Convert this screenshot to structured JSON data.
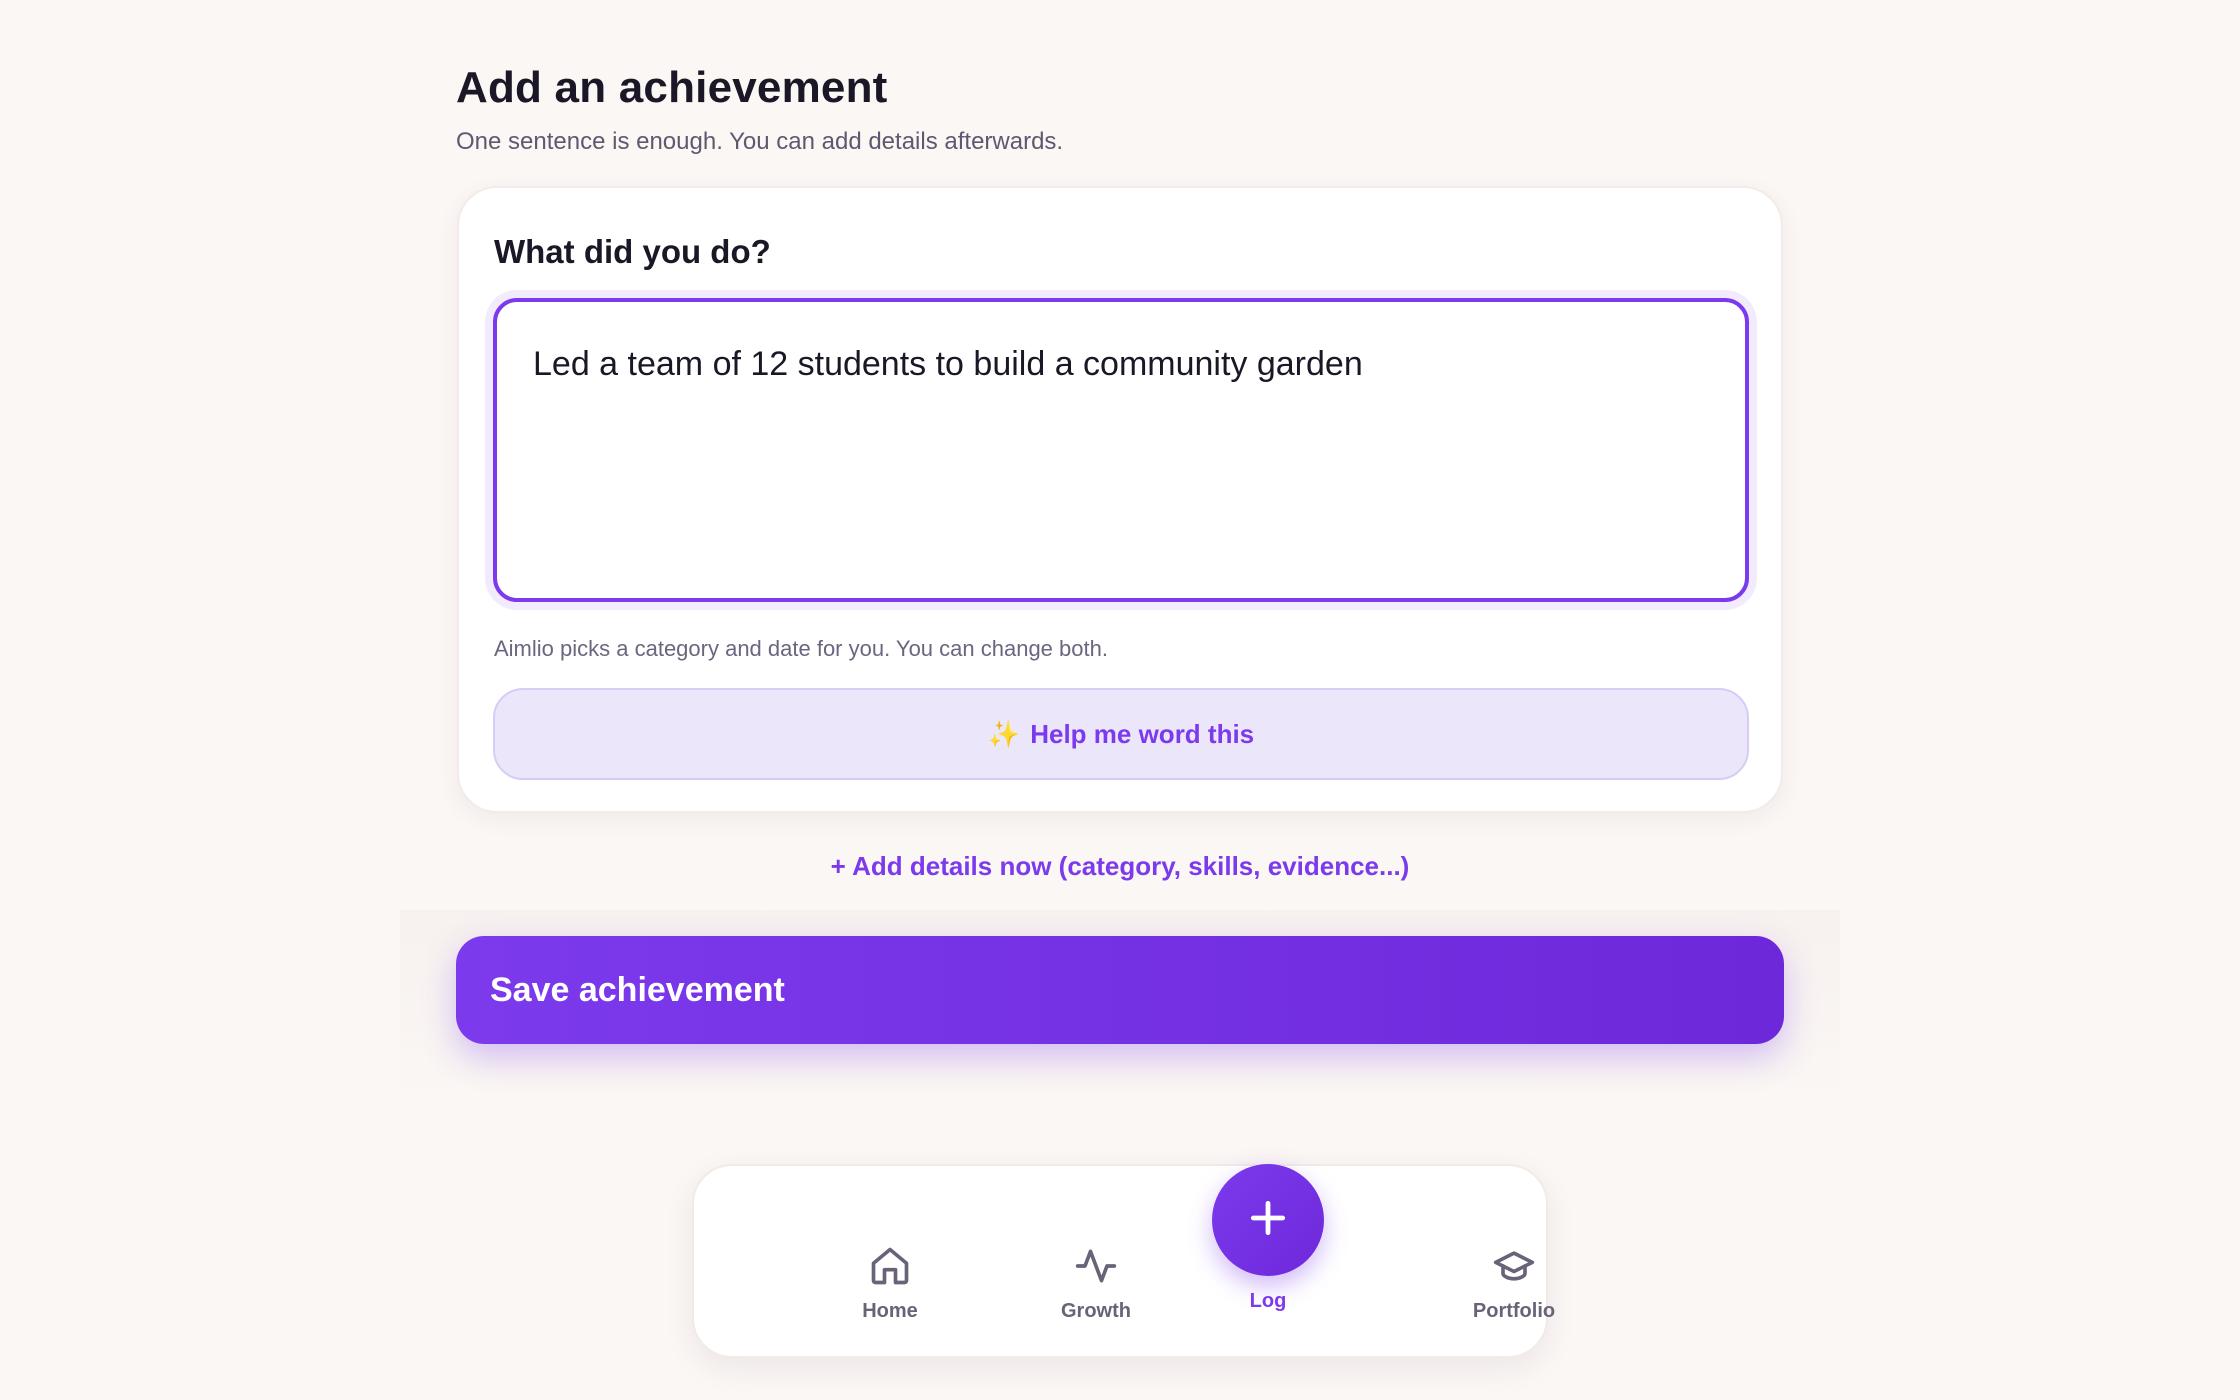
{
  "header": {
    "title": "Add an achievement",
    "subtitle": "One sentence is enough. You can add details afterwards."
  },
  "form": {
    "question_label": "What did you do?",
    "textarea_value": "Led a team of 12 students to build a community garden",
    "hint": "Aimlio picks a category and date for you. You can change both.",
    "ai_button_label": "Help me word this",
    "ai_button_icon": "sparkles-icon"
  },
  "details_link": "+ Add details now (category, skills, evidence...)",
  "save_button_label": "Save achievement",
  "colors": {
    "accent": "#7c3aed",
    "accent_dark": "#6d28d9",
    "background": "#fbf7f4",
    "ai_button_bg": "#ece6fb"
  },
  "nav": {
    "items": [
      {
        "label": "Home",
        "icon": "home-icon"
      },
      {
        "label": "Growth",
        "icon": "activity-icon"
      },
      {
        "label": "Log",
        "icon": "plus-icon",
        "active": true
      },
      {
        "label": "Portfolio",
        "icon": "graduation-cap-icon"
      }
    ]
  }
}
